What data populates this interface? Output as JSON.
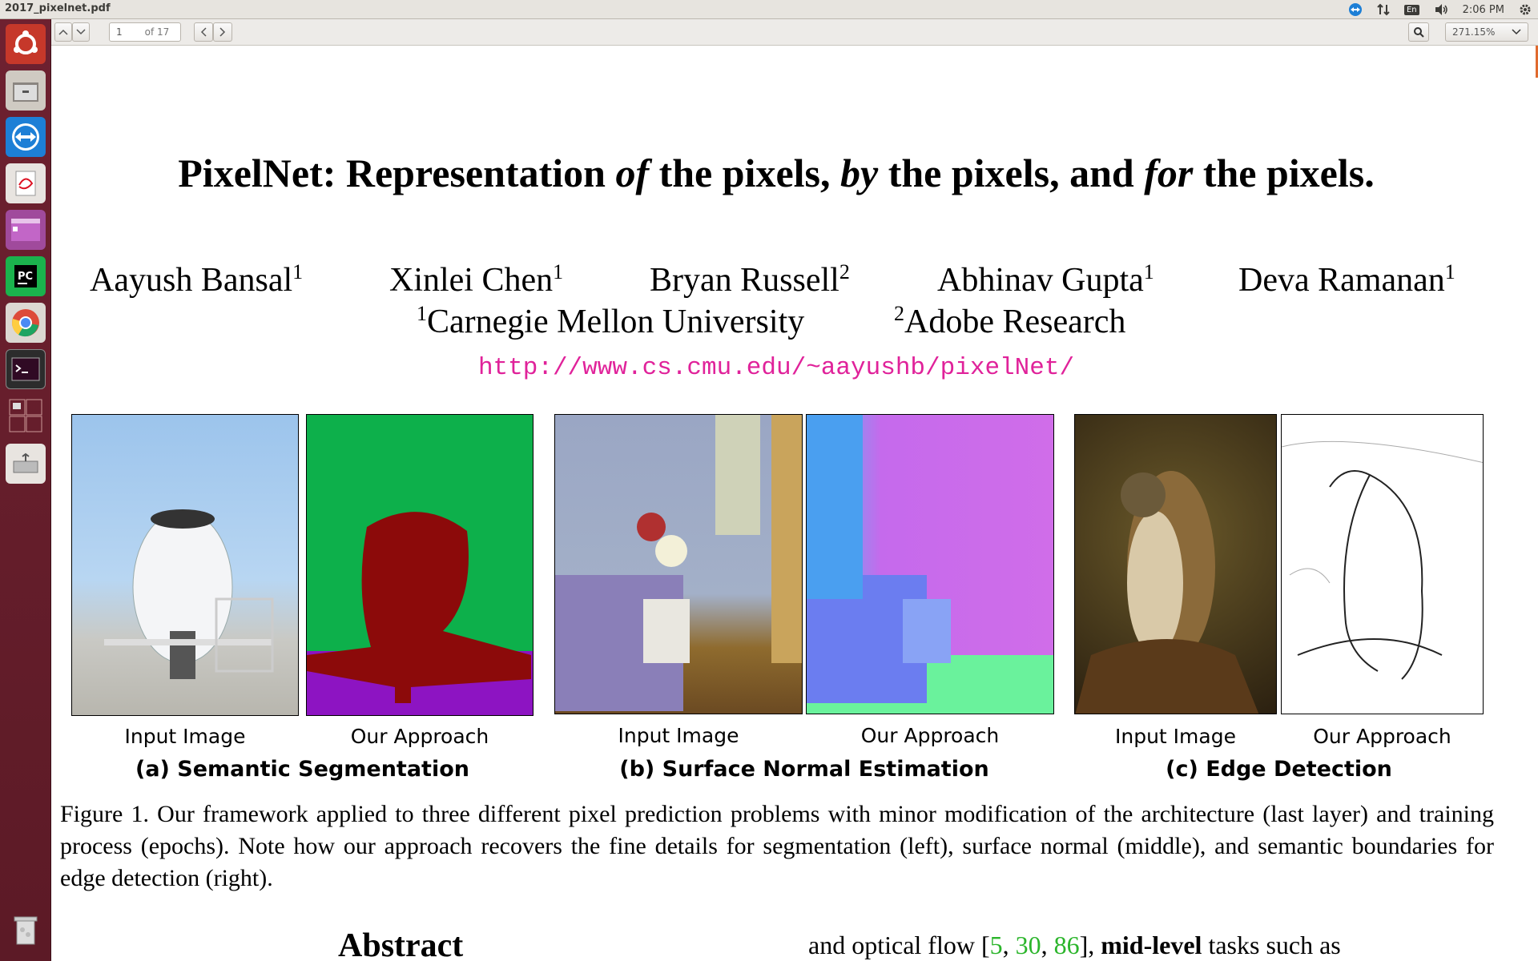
{
  "window": {
    "title": "2017_pixelnet.pdf"
  },
  "tray": {
    "lang": "En",
    "time": "2:06 PM"
  },
  "toolbar": {
    "page_value": "1",
    "page_total": "of 17",
    "zoom": "271.15%"
  },
  "paper": {
    "title_parts": [
      "PixelNet: Representation ",
      "of",
      " the pixels, ",
      "by",
      " the pixels, and ",
      "for",
      " the pixels."
    ],
    "authors": [
      {
        "name": "Aayush Bansal",
        "sup": "1"
      },
      {
        "name": "Xinlei Chen",
        "sup": "1"
      },
      {
        "name": "Bryan Russell",
        "sup": "2"
      },
      {
        "name": "Abhinav Gupta",
        "sup": "1"
      },
      {
        "name": "Deva Ramanan",
        "sup": "1"
      }
    ],
    "affiliations": [
      {
        "sup": "1",
        "name": "Carnegie Mellon University"
      },
      {
        "sup": "2",
        "name": "Adobe Research"
      }
    ],
    "url": "http://www.cs.cmu.edu/~aayushb/pixelNet/",
    "figure": {
      "image_captions": [
        "Input Image",
        "Our Approach",
        "Input Image",
        "Our Approach",
        "Input Image",
        "Our Approach"
      ],
      "subcaptions": [
        "(a) Semantic Segmentation",
        "(b) Surface Normal Estimation",
        "(c) Edge Detection"
      ],
      "caption": "Figure 1. Our framework applied to three different pixel prediction problems with minor modification of the architecture (last layer) and training process (epochs). Note how our approach recovers the fine details for segmentation (left), surface normal (middle), and semantic boundaries for edge detection (right)."
    },
    "abstract_heading": "Abstract",
    "right_column": {
      "text_start": "and optical flow [",
      "refs": [
        "5",
        "30",
        "86"
      ],
      "text_bold": "mid-level",
      "text_end": " tasks such as"
    }
  }
}
